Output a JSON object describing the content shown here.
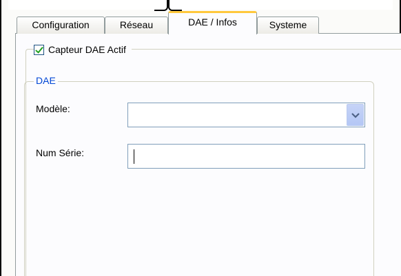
{
  "tabs": [
    {
      "label": "Configuration",
      "active": false
    },
    {
      "label": "Réseau",
      "active": false
    },
    {
      "label": "DAE / Infos",
      "active": true
    },
    {
      "label": "Systeme",
      "active": false
    }
  ],
  "sensor": {
    "checkbox_label": "Capteur DAE Actif",
    "checked": true
  },
  "dae_group": {
    "title": "DAE",
    "model_label": "Modèle:",
    "model_value": "",
    "serial_label": "Num Série:",
    "serial_value": ""
  },
  "colors": {
    "group_title": "#0046d5",
    "active_tab_accent": "#ffc83c",
    "checkmark": "#21a121"
  }
}
